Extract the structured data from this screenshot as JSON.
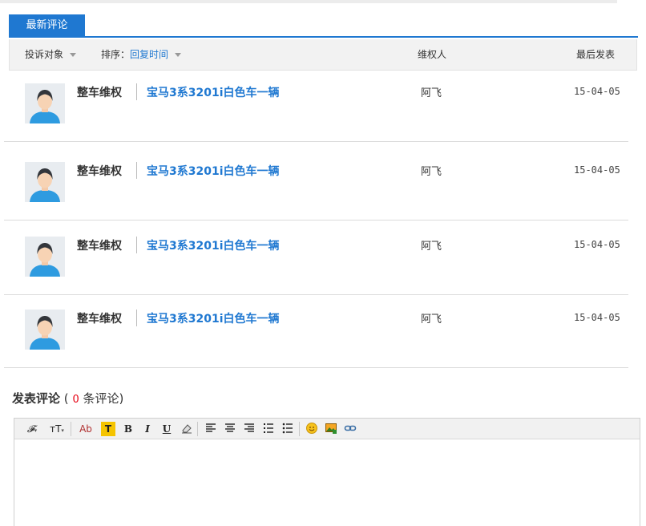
{
  "tabs": {
    "active_label": "最新评论"
  },
  "list_header": {
    "filter_label": "投诉对象",
    "sort_prefix": "排序：",
    "sort_value": "回复时间",
    "col_owner": "维权人",
    "col_last": "最后发表"
  },
  "rows": [
    {
      "category": "整车维权",
      "title": "宝马3系3201i白色车一辆",
      "author": "阿飞",
      "date": "15-04-05"
    },
    {
      "category": "整车维权",
      "title": "宝马3系3201i白色车一辆",
      "author": "阿飞",
      "date": "15-04-05"
    },
    {
      "category": "整车维权",
      "title": "宝马3系3201i白色车一辆",
      "author": "阿飞",
      "date": "15-04-05"
    },
    {
      "category": "整车维权",
      "title": "宝马3系3201i白色车一辆",
      "author": "阿飞",
      "date": "15-04-05"
    }
  ],
  "comment": {
    "title": "发表评论",
    "open_paren": "(",
    "count": "0",
    "suffix": "条评论)"
  },
  "editor": {
    "font_btn": "𝓕",
    "size_btn": "тT",
    "color_btn": "Ab",
    "bg_btn": "T",
    "bold": "B",
    "italic": "I",
    "underline": "U",
    "icons": [
      "font-icon",
      "font-size-icon",
      "text-color-icon",
      "highlight-icon",
      "bold-icon",
      "italic-icon",
      "underline-icon",
      "eraser-icon",
      "align-left-icon",
      "align-center-icon",
      "align-right-icon",
      "ordered-list-icon",
      "unordered-list-icon",
      "emoji-icon",
      "image-icon",
      "link-icon"
    ]
  },
  "colors": {
    "accent": "#1f78d1",
    "count_red": "#e60012",
    "header_bg": "#f2f2f2"
  }
}
